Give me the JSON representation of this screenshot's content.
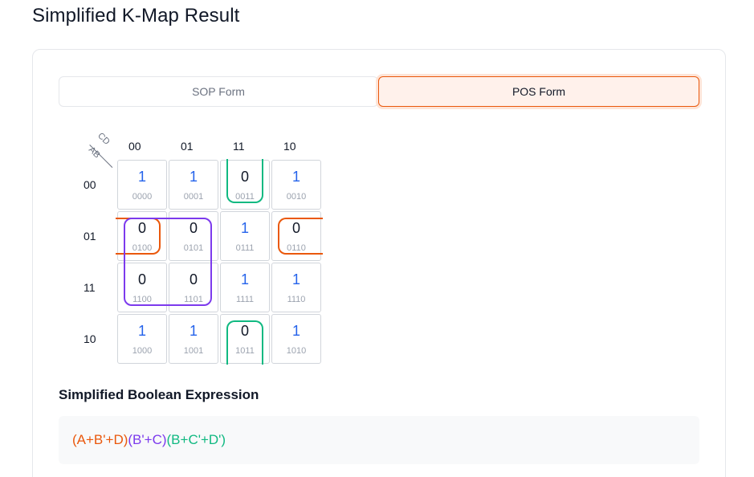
{
  "page": {
    "title": "Simplified K-Map Result"
  },
  "tabs": {
    "sop_label": "SOP Form",
    "pos_label": "POS Form",
    "active": "POS Form"
  },
  "kmap": {
    "col_var": "CD",
    "row_var": "AB",
    "col_labels": [
      "00",
      "01",
      "11",
      "10"
    ],
    "row_labels": [
      "00",
      "01",
      "11",
      "10"
    ],
    "rows": [
      [
        {
          "value": "1",
          "bits": "0000"
        },
        {
          "value": "1",
          "bits": "0001"
        },
        {
          "value": "0",
          "bits": "0011"
        },
        {
          "value": "1",
          "bits": "0010"
        }
      ],
      [
        {
          "value": "0",
          "bits": "0100"
        },
        {
          "value": "0",
          "bits": "0101"
        },
        {
          "value": "1",
          "bits": "0111"
        },
        {
          "value": "0",
          "bits": "0110"
        }
      ],
      [
        {
          "value": "0",
          "bits": "1100"
        },
        {
          "value": "0",
          "bits": "1101"
        },
        {
          "value": "1",
          "bits": "1111"
        },
        {
          "value": "1",
          "bits": "1110"
        }
      ],
      [
        {
          "value": "1",
          "bits": "1000"
        },
        {
          "value": "1",
          "bits": "1001"
        },
        {
          "value": "0",
          "bits": "1011"
        },
        {
          "value": "1",
          "bits": "1010"
        }
      ]
    ],
    "groups": [
      {
        "term": "(A+B'+D)",
        "color": "#ea580c",
        "cells": [
          "0100",
          "0110"
        ]
      },
      {
        "term": "(B'+C)",
        "color": "#7c3aed",
        "cells": [
          "0100",
          "0101",
          "1100",
          "1101"
        ]
      },
      {
        "term": "(B+C'+D')",
        "color": "#10b981",
        "cells": [
          "0011",
          "1011"
        ]
      }
    ]
  },
  "expression": {
    "title": "Simplified Boolean Expression",
    "terms": [
      "(A+B'+D)",
      "(B'+C)",
      "(B+C'+D')"
    ]
  }
}
